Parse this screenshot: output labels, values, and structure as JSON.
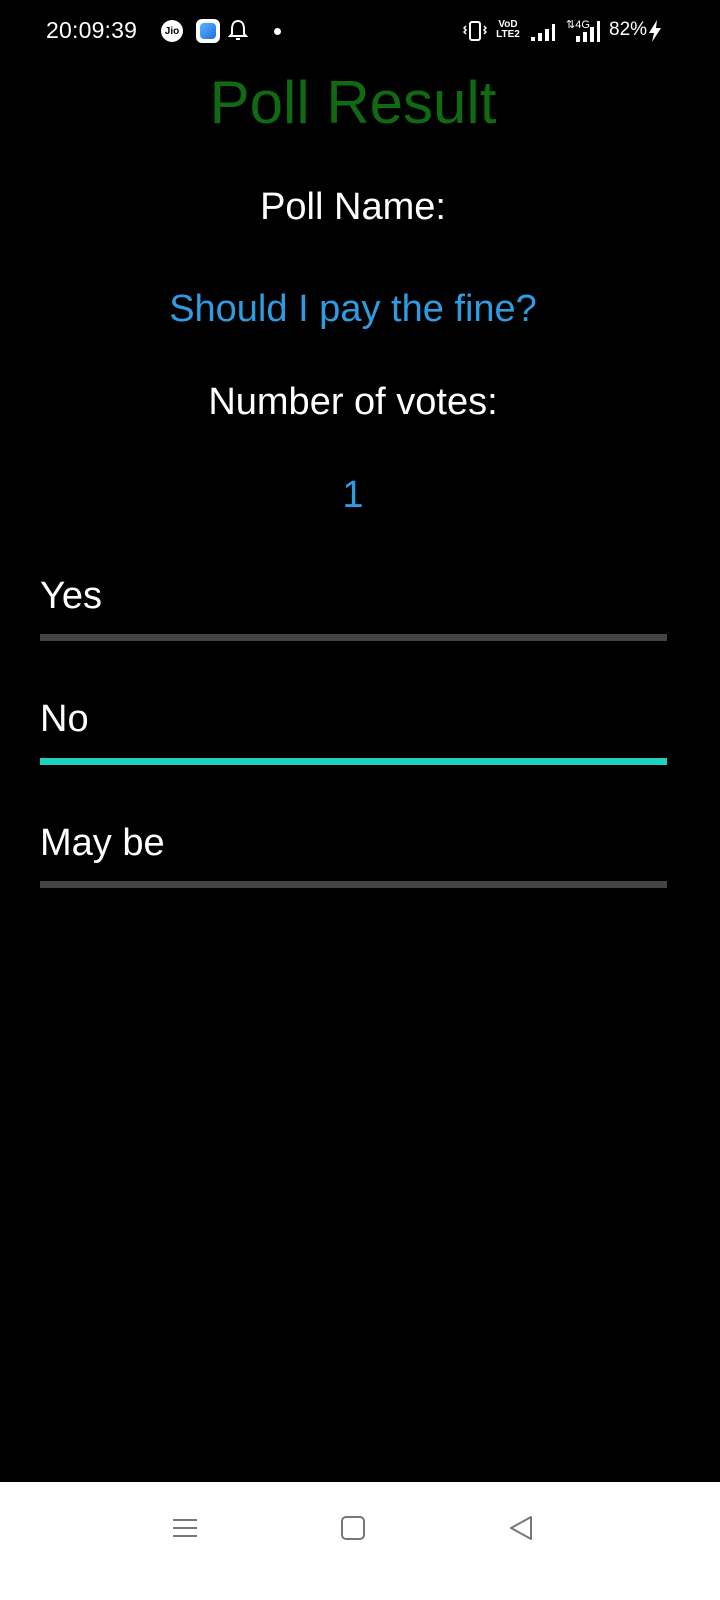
{
  "status_bar": {
    "time": "20:09:39",
    "jio_label": "Jio",
    "volte_label": "VoD LTE2",
    "network_label": "4G",
    "battery": "82%"
  },
  "header": {
    "title": "Poll Result"
  },
  "poll": {
    "name_label": "Poll Name:",
    "name_value": "Should I pay the fine?",
    "votes_label": "Number of votes:",
    "votes_value": "1"
  },
  "options": [
    {
      "label": "Yes",
      "fraction": 0.0
    },
    {
      "label": "No",
      "fraction": 1.0
    },
    {
      "label": "May be",
      "fraction": 0.0
    }
  ],
  "colors": {
    "title": "#0f6a12",
    "value": "#2f9be0",
    "bar_fill": "#1fd1bf",
    "bar_track": "#444444"
  }
}
